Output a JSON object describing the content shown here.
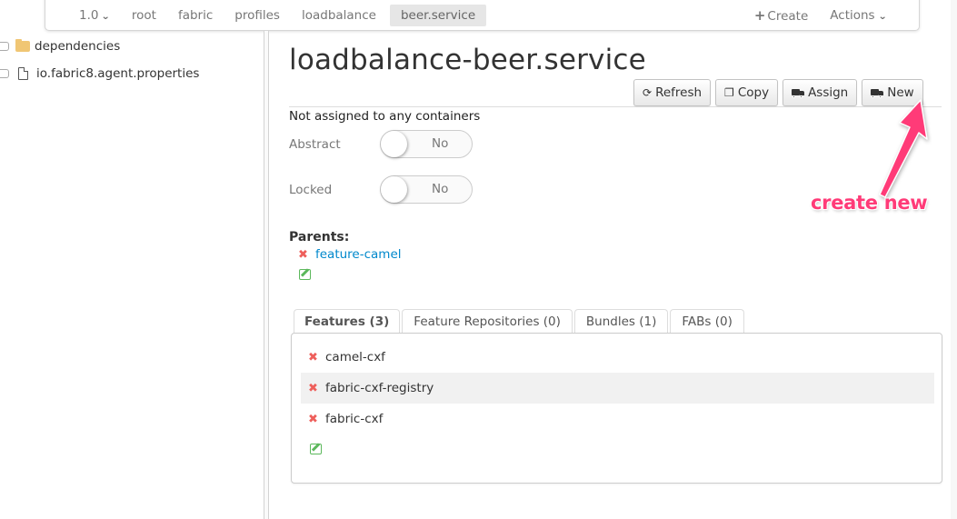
{
  "topbar": {
    "version": "1.0",
    "crumbs": [
      "root",
      "fabric",
      "profiles",
      "loadbalance"
    ],
    "active_crumb": "beer.service",
    "create_label": "Create",
    "actions_label": "Actions"
  },
  "tree": {
    "items": [
      {
        "label": "dependencies",
        "icon": "folder-icon"
      },
      {
        "label": "io.fabric8.agent.properties",
        "icon": "file-icon"
      }
    ]
  },
  "main": {
    "title": "loadbalance-beer.service",
    "buttons": [
      {
        "label": "Refresh",
        "icon": "refresh-icon"
      },
      {
        "label": "Copy",
        "icon": "copy-icon"
      },
      {
        "label": "Assign",
        "icon": "truck-icon"
      },
      {
        "label": "New",
        "icon": "truck-icon"
      }
    ],
    "assignment_status": "Not assigned to any containers",
    "fields": [
      {
        "label": "Abstract",
        "value": "No"
      },
      {
        "label": "Locked",
        "value": "No"
      }
    ],
    "parents_label": "Parents:",
    "parents": [
      "feature-camel"
    ],
    "tabs": [
      {
        "label": "Features (3)",
        "active": true
      },
      {
        "label": "Feature Repositories (0)",
        "active": false
      },
      {
        "label": "Bundles (1)",
        "active": false
      },
      {
        "label": "FABs (0)",
        "active": false
      }
    ],
    "features": [
      "camel-cxf",
      "fabric-cxf-registry",
      "fabric-cxf"
    ]
  },
  "annotation": {
    "text": "create new",
    "color": "#ff3b78"
  },
  "colors": {
    "link": "#0088cc",
    "remove": "#ee5f5b",
    "edit": "#5cb85c",
    "folder": "#f0c674"
  }
}
